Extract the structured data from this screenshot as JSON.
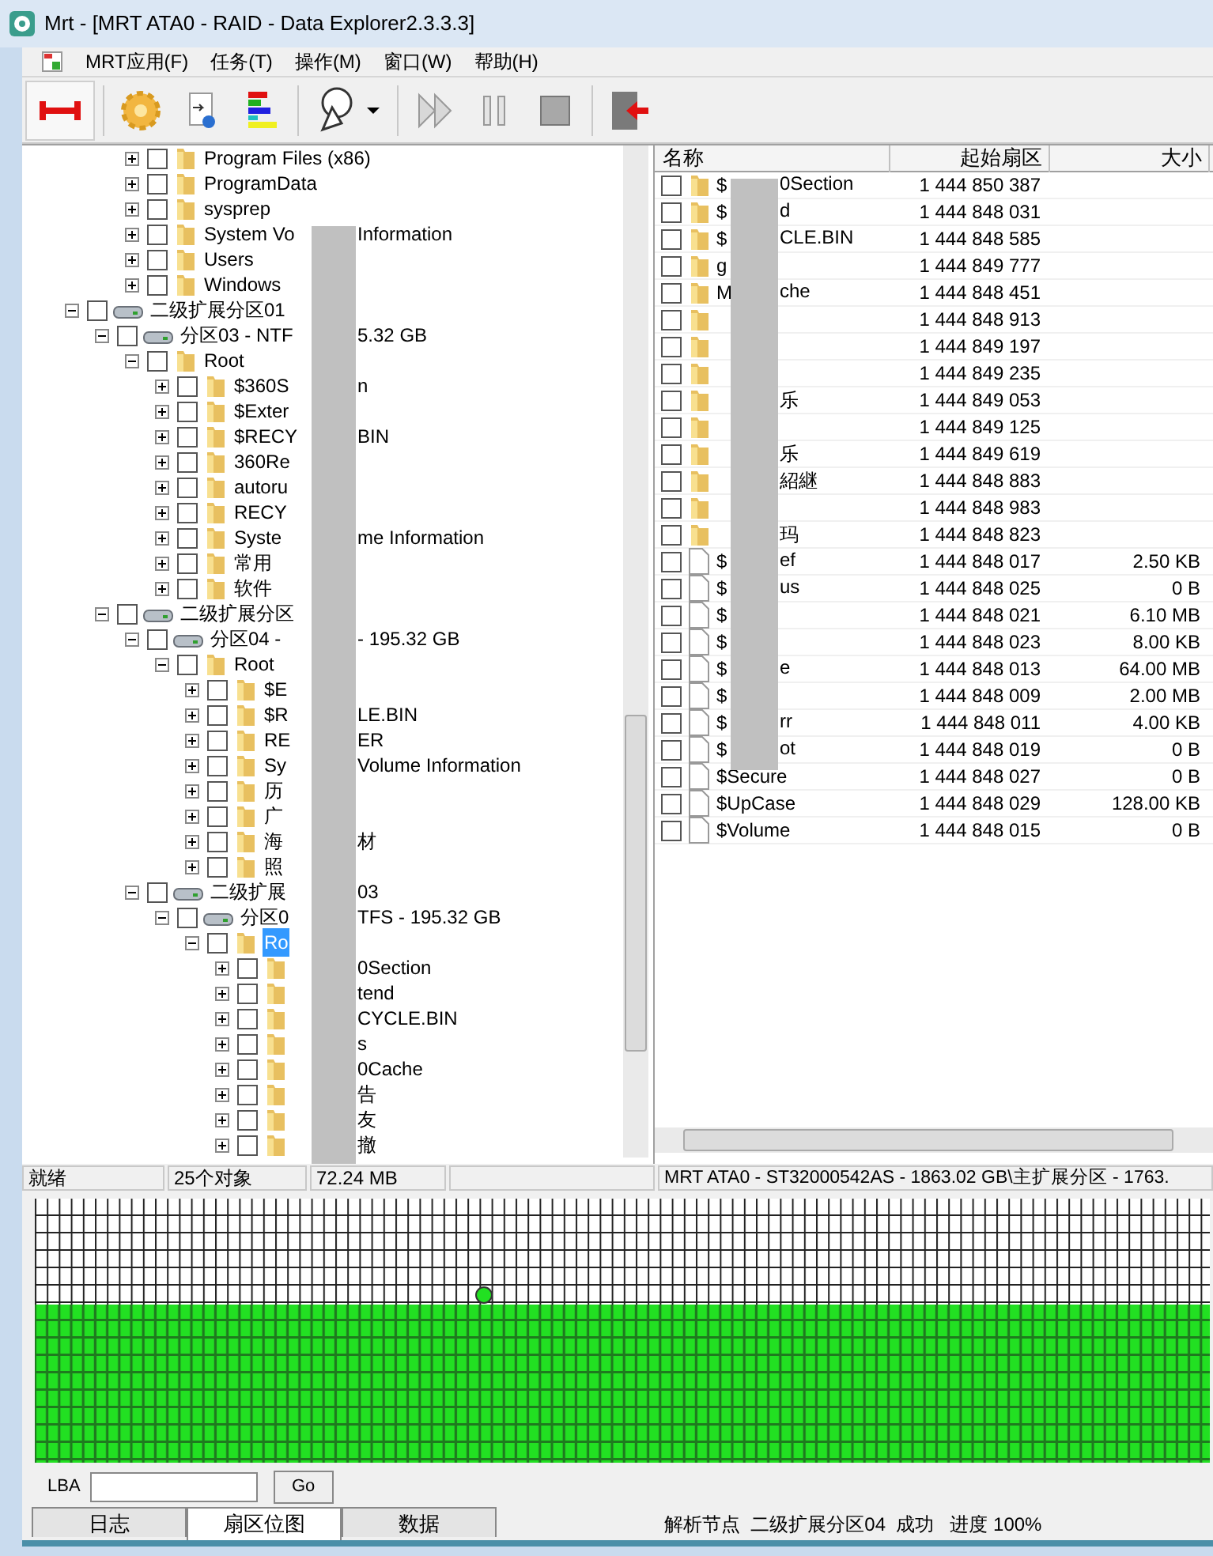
{
  "window": {
    "title": "Mrt - [MRT ATA0 - RAID - Data Explorer2.3.3.3]"
  },
  "menu": [
    "MRT应用(F)",
    "任务(T)",
    "操作(M)",
    "窗口(W)",
    "帮助(H)"
  ],
  "toolbar": [
    {
      "kind": "link",
      "pressed": true
    },
    {
      "kind": "gear",
      "pressed": false
    },
    {
      "kind": "info",
      "pressed": false
    },
    {
      "kind": "bars",
      "pressed": false
    },
    {
      "kind": "dial",
      "pressed": false
    },
    {
      "kind": "forward",
      "pressed": false
    },
    {
      "kind": "pause",
      "pressed": false
    },
    {
      "kind": "stop",
      "pressed": false
    },
    {
      "kind": "exit",
      "pressed": false
    }
  ],
  "tree": [
    {
      "children": [
        {
          "children": [
            {
              "children": [
                {
                  "kind": "folder",
                  "label": "Program Files (x86)",
                  "expanded": false,
                  "checked": false,
                  "selected": false
                },
                {
                  "kind": "folder",
                  "label": "ProgramData",
                  "expanded": false,
                  "checked": false,
                  "selected": false
                },
                {
                  "kind": "folder",
                  "label": "sysprep",
                  "expanded": false,
                  "checked": false,
                  "selected": false
                },
                {
                  "kind": "folder",
                  "label": "System Vo",
                  "label_after": "Information",
                  "expanded": false,
                  "checked": false,
                  "selected": false
                },
                {
                  "kind": "folder",
                  "label": "Users",
                  "expanded": false,
                  "checked": false,
                  "selected": false
                },
                {
                  "kind": "folder",
                  "label": "Windows",
                  "expanded": false,
                  "checked": false,
                  "selected": false
                }
              ]
            }
          ]
        },
        {
          "kind": "drive",
          "label": "二级扩展分区01",
          "expanded": true,
          "checked": false,
          "selected": false,
          "children": [
            {
              "kind": "drive",
              "label": "分区03 - NTF",
              "label_after": "5.32 GB",
              "expanded": true,
              "checked": false,
              "selected": false,
              "children": [
                {
                  "kind": "folder",
                  "label": "Root",
                  "expanded": true,
                  "checked": false,
                  "selected": false,
                  "children": [
                    {
                      "kind": "folder",
                      "label": "$360S",
                      "label_after": "n",
                      "expanded": false,
                      "checked": false,
                      "selected": false
                    },
                    {
                      "kind": "folder",
                      "label": "$Exter",
                      "expanded": false,
                      "checked": false,
                      "selected": false
                    },
                    {
                      "kind": "folder",
                      "label": "$RECY",
                      "label_after": "BIN",
                      "expanded": false,
                      "checked": false,
                      "selected": false
                    },
                    {
                      "kind": "folder",
                      "label": "360Re",
                      "expanded": false,
                      "checked": false,
                      "selected": false
                    },
                    {
                      "kind": "folder",
                      "label": "autoru",
                      "expanded": false,
                      "checked": false,
                      "selected": false
                    },
                    {
                      "kind": "folder",
                      "label": "RECY",
                      "expanded": false,
                      "checked": false,
                      "selected": false
                    },
                    {
                      "kind": "folder",
                      "label": "Syste",
                      "label_after": "me Information",
                      "expanded": false,
                      "checked": false,
                      "selected": false
                    },
                    {
                      "kind": "folder",
                      "label": "常用",
                      "expanded": false,
                      "checked": false,
                      "selected": false
                    },
                    {
                      "kind": "folder",
                      "label": "软件",
                      "expanded": false,
                      "checked": false,
                      "selected": false
                    }
                  ]
                }
              ]
            },
            {
              "kind": "drive",
              "label": "二级扩展分区",
              "expanded": true,
              "checked": false,
              "selected": false,
              "children": [
                {
                  "kind": "drive",
                  "label": "分区04 -",
                  "label_after": "- 195.32 GB",
                  "expanded": true,
                  "checked": false,
                  "selected": false,
                  "children": [
                    {
                      "kind": "folder",
                      "label": "Root",
                      "expanded": true,
                      "checked": false,
                      "selected": false,
                      "children": [
                        {
                          "kind": "folder",
                          "label": "$E",
                          "expanded": false,
                          "checked": false,
                          "selected": false
                        },
                        {
                          "kind": "folder",
                          "label": "$R",
                          "label_after": "LE.BIN",
                          "expanded": false,
                          "checked": false,
                          "selected": false
                        },
                        {
                          "kind": "folder",
                          "label": "RE",
                          "label_after": "ER",
                          "expanded": false,
                          "checked": false,
                          "selected": false
                        },
                        {
                          "kind": "folder",
                          "label": "Sy",
                          "label_after": "Volume Information",
                          "expanded": false,
                          "checked": false,
                          "selected": false
                        },
                        {
                          "kind": "folder",
                          "label": "历",
                          "expanded": false,
                          "checked": false,
                          "selected": false
                        },
                        {
                          "kind": "folder",
                          "label": "广",
                          "expanded": false,
                          "checked": false,
                          "selected": false
                        },
                        {
                          "kind": "folder",
                          "label": "海",
                          "label_after": "材",
                          "expanded": false,
                          "checked": false,
                          "selected": false
                        },
                        {
                          "kind": "folder",
                          "label": "照",
                          "expanded": false,
                          "checked": false,
                          "selected": false
                        }
                      ]
                    }
                  ]
                },
                {
                  "kind": "drive",
                  "label": "二级扩展",
                  "label_after": "03",
                  "expanded": true,
                  "checked": false,
                  "selected": false,
                  "children": [
                    {
                      "kind": "drive",
                      "label": "分区0",
                      "label_after": "TFS - 195.32 GB",
                      "expanded": true,
                      "checked": false,
                      "selected": false,
                      "children": [
                        {
                          "kind": "folder",
                          "label": "Ro",
                          "expanded": true,
                          "checked": false,
                          "selected": true,
                          "children": [
                            {
                              "kind": "folder",
                              "label_after": "0Section",
                              "expanded": false,
                              "checked": false
                            },
                            {
                              "kind": "folder",
                              "label_after": "tend",
                              "expanded": false,
                              "checked": false
                            },
                            {
                              "kind": "folder",
                              "label_after": "CYCLE.BIN",
                              "expanded": false,
                              "checked": false
                            },
                            {
                              "kind": "folder",
                              "label_after": "s",
                              "expanded": false,
                              "checked": false
                            },
                            {
                              "kind": "folder",
                              "label_after": "0Cache",
                              "expanded": false,
                              "checked": false
                            },
                            {
                              "kind": "folder",
                              "label_after": "告",
                              "expanded": false,
                              "checked": false
                            },
                            {
                              "kind": "folder",
                              "label_after": "友",
                              "expanded": false,
                              "checked": false
                            },
                            {
                              "kind": "folder",
                              "label_after": "撤",
                              "expanded": false,
                              "checked": false
                            }
                          ]
                        }
                      ]
                    }
                  ]
                }
              ]
            }
          ]
        }
      ]
    }
  ],
  "files": {
    "columns": [
      "名称",
      "起始扇区",
      "大小"
    ],
    "rows": [
      {
        "kind": "folder",
        "checked": false,
        "name": "$",
        "name_after": "0Section",
        "start": "1 444 850 387"
      },
      {
        "kind": "folder",
        "checked": false,
        "name": "$",
        "name_after": "d",
        "start": "1 444 848 031"
      },
      {
        "kind": "folder",
        "checked": false,
        "name": "$",
        "name_after": "CLE.BIN",
        "start": "1 444 848 585"
      },
      {
        "kind": "folder",
        "checked": false,
        "name": "g",
        "start": "1 444 849 777"
      },
      {
        "kind": "folder",
        "checked": false,
        "name": "M",
        "name_after": "che",
        "start": "1 444 848 451"
      },
      {
        "kind": "folder",
        "checked": false,
        "start": "1 444 848 913"
      },
      {
        "kind": "folder",
        "checked": false,
        "start": "1 444 849 197"
      },
      {
        "kind": "folder",
        "checked": false,
        "start": "1 444 849 235"
      },
      {
        "kind": "folder",
        "checked": false,
        "name_after": "乐",
        "start": "1 444 849 053"
      },
      {
        "kind": "folder",
        "checked": false,
        "start": "1 444 849 125"
      },
      {
        "kind": "folder",
        "checked": false,
        "name_after": "乐",
        "start": "1 444 849 619"
      },
      {
        "kind": "folder",
        "checked": false,
        "name_after": "紹継",
        "start": "1 444 848 883"
      },
      {
        "kind": "folder",
        "checked": false,
        "start": "1 444 848 983"
      },
      {
        "kind": "folder",
        "checked": false,
        "name_after": "玛",
        "start": "1 444 848 823"
      },
      {
        "kind": "file",
        "checked": false,
        "name": "$",
        "name_after": "ef",
        "start": "1 444 848 017",
        "size": "2.50 KB"
      },
      {
        "kind": "file",
        "checked": false,
        "name": "$",
        "name_after": "us",
        "start": "1 444 848 025",
        "size": "0 B"
      },
      {
        "kind": "file",
        "checked": false,
        "name": "$",
        "start": "1 444 848 021",
        "size": "6.10 MB"
      },
      {
        "kind": "file",
        "checked": false,
        "name": "$",
        "start": "1 444 848 023",
        "size": "8.00 KB"
      },
      {
        "kind": "file",
        "checked": false,
        "name": "$",
        "name_after": "e",
        "start": "1 444 848 013",
        "size": "64.00 MB"
      },
      {
        "kind": "file",
        "checked": false,
        "name": "$",
        "start": "1 444 848 009",
        "size": "2.00 MB"
      },
      {
        "kind": "file",
        "checked": false,
        "name": "$",
        "name_after": "rr",
        "start": "1 444 848 011",
        "size": "4.00 KB"
      },
      {
        "kind": "file",
        "checked": false,
        "name": "$",
        "name_after": "ot",
        "start": "1 444 848 019",
        "size": "0 B"
      },
      {
        "kind": "file",
        "checked": false,
        "name": "$Secure",
        "start": "1 444 848 027",
        "size": "0 B"
      },
      {
        "kind": "file",
        "checked": false,
        "name": "$UpCase",
        "start": "1 444 848 029",
        "size": "128.00 KB"
      },
      {
        "kind": "file",
        "checked": false,
        "name": "$Volume",
        "start": "1 444 848 015",
        "size": "0 B"
      }
    ]
  },
  "status_bar": {
    "state": "就绪",
    "objects": "25个对象",
    "size": "72.24 MB",
    "device": "MRT ATA0 - ST32000542AS - 1863.02 GB\\主扩展分区 - 1763."
  },
  "lba": {
    "label": "LBA",
    "button": "Go"
  },
  "bottom_tabs": [
    {
      "label": "日志",
      "selected": false
    },
    {
      "label": "扇区位图",
      "selected": true
    },
    {
      "label": "数据",
      "selected": false
    }
  ],
  "progress_message": "解析节点  二级扩展分区04  成功   进度 100%"
}
